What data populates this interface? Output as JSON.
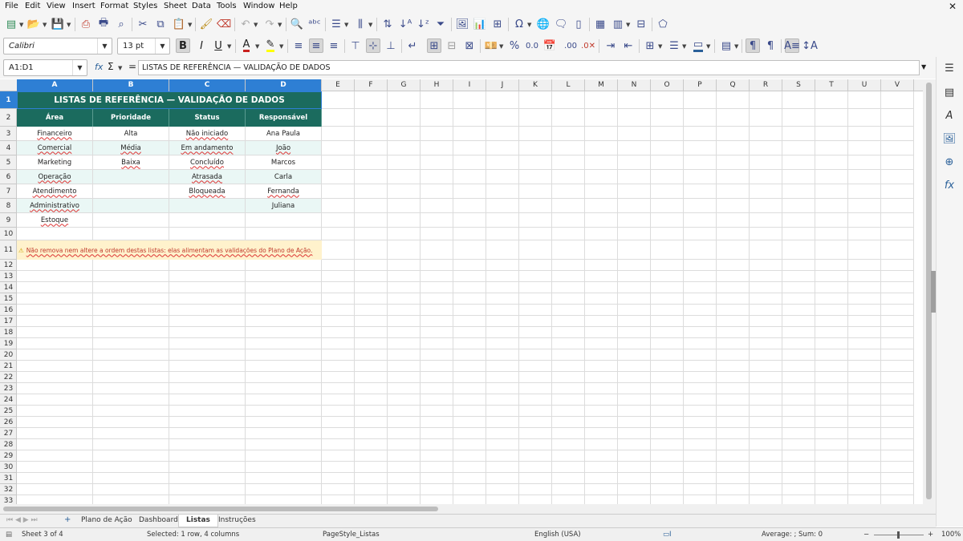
{
  "menu": [
    "File",
    "Edit",
    "View",
    "Insert",
    "Format",
    "Styles",
    "Sheet",
    "Data",
    "Tools",
    "Window",
    "Help"
  ],
  "formatting": {
    "font_name": "Calibri",
    "font_size": "13 pt",
    "font_color": "#c9211e",
    "highlight_color": "#ffff00",
    "border_color": "#2a6099"
  },
  "formula_bar": {
    "name_box": "A1:D1",
    "formula": "LISTAS DE REFERÊNCIA — VALIDAÇÃO DE DADOS",
    "fx": "fx",
    "sigma": "Σ",
    "equals": "="
  },
  "columns": [
    "A",
    "B",
    "C",
    "D",
    "E",
    "F",
    "G",
    "H",
    "I",
    "J",
    "K",
    "L",
    "M",
    "N",
    "O",
    "P",
    "Q",
    "R",
    "S",
    "T",
    "U",
    "V"
  ],
  "rows": [
    "1",
    "2",
    "3",
    "4",
    "5",
    "6",
    "7",
    "8",
    "9",
    "10",
    "11",
    "12",
    "13",
    "14",
    "15",
    "16",
    "17",
    "18",
    "19",
    "20",
    "21",
    "22",
    "23",
    "24",
    "25",
    "26",
    "27",
    "28",
    "29",
    "30",
    "31",
    "32",
    "33"
  ],
  "sheet": {
    "title": "LISTAS DE REFERÊNCIA — VALIDAÇÃO DE DADOS",
    "headers": [
      "Área",
      "Prioridade",
      "Status",
      "Responsável"
    ],
    "data": [
      [
        "Financeiro",
        "Alta",
        "Não iniciado",
        "Ana Paula"
      ],
      [
        "Comercial",
        "Média",
        "Em andamento",
        "João"
      ],
      [
        "Marketing",
        "Baixa",
        "Concluído",
        "Marcos"
      ],
      [
        "Operação",
        "",
        "Atrasada",
        "Carla"
      ],
      [
        "Atendimento",
        "",
        "Bloqueada",
        "Fernanda"
      ],
      [
        "Administrativo",
        "",
        "",
        "Juliana"
      ],
      [
        "Estoque",
        "",
        "",
        ""
      ]
    ],
    "warning_icon": "⚠",
    "warning": "Não remova nem altere a ordem destas listas: elas alimentam as validações do Plano de Ação.",
    "colors": {
      "title_bg": "#1b6b5e",
      "header_bg": "#1b6b5e",
      "stripe": "#eaf7f5",
      "warn_bg": "#fff2cc",
      "warn_text": "#c0392b",
      "selection": "#2e7fd4"
    }
  },
  "tabs": [
    "Plano de Ação",
    "Dashboard",
    "Listas",
    "Instruções"
  ],
  "active_tab": "Listas",
  "status": {
    "sheet": "Sheet 3 of 4",
    "selection": "Selected: 1 row, 4 columns",
    "page_style": "PageStyle_Listas",
    "language": "English (USA)",
    "summary": "Average: ; Sum: 0",
    "zoom": "100%"
  }
}
